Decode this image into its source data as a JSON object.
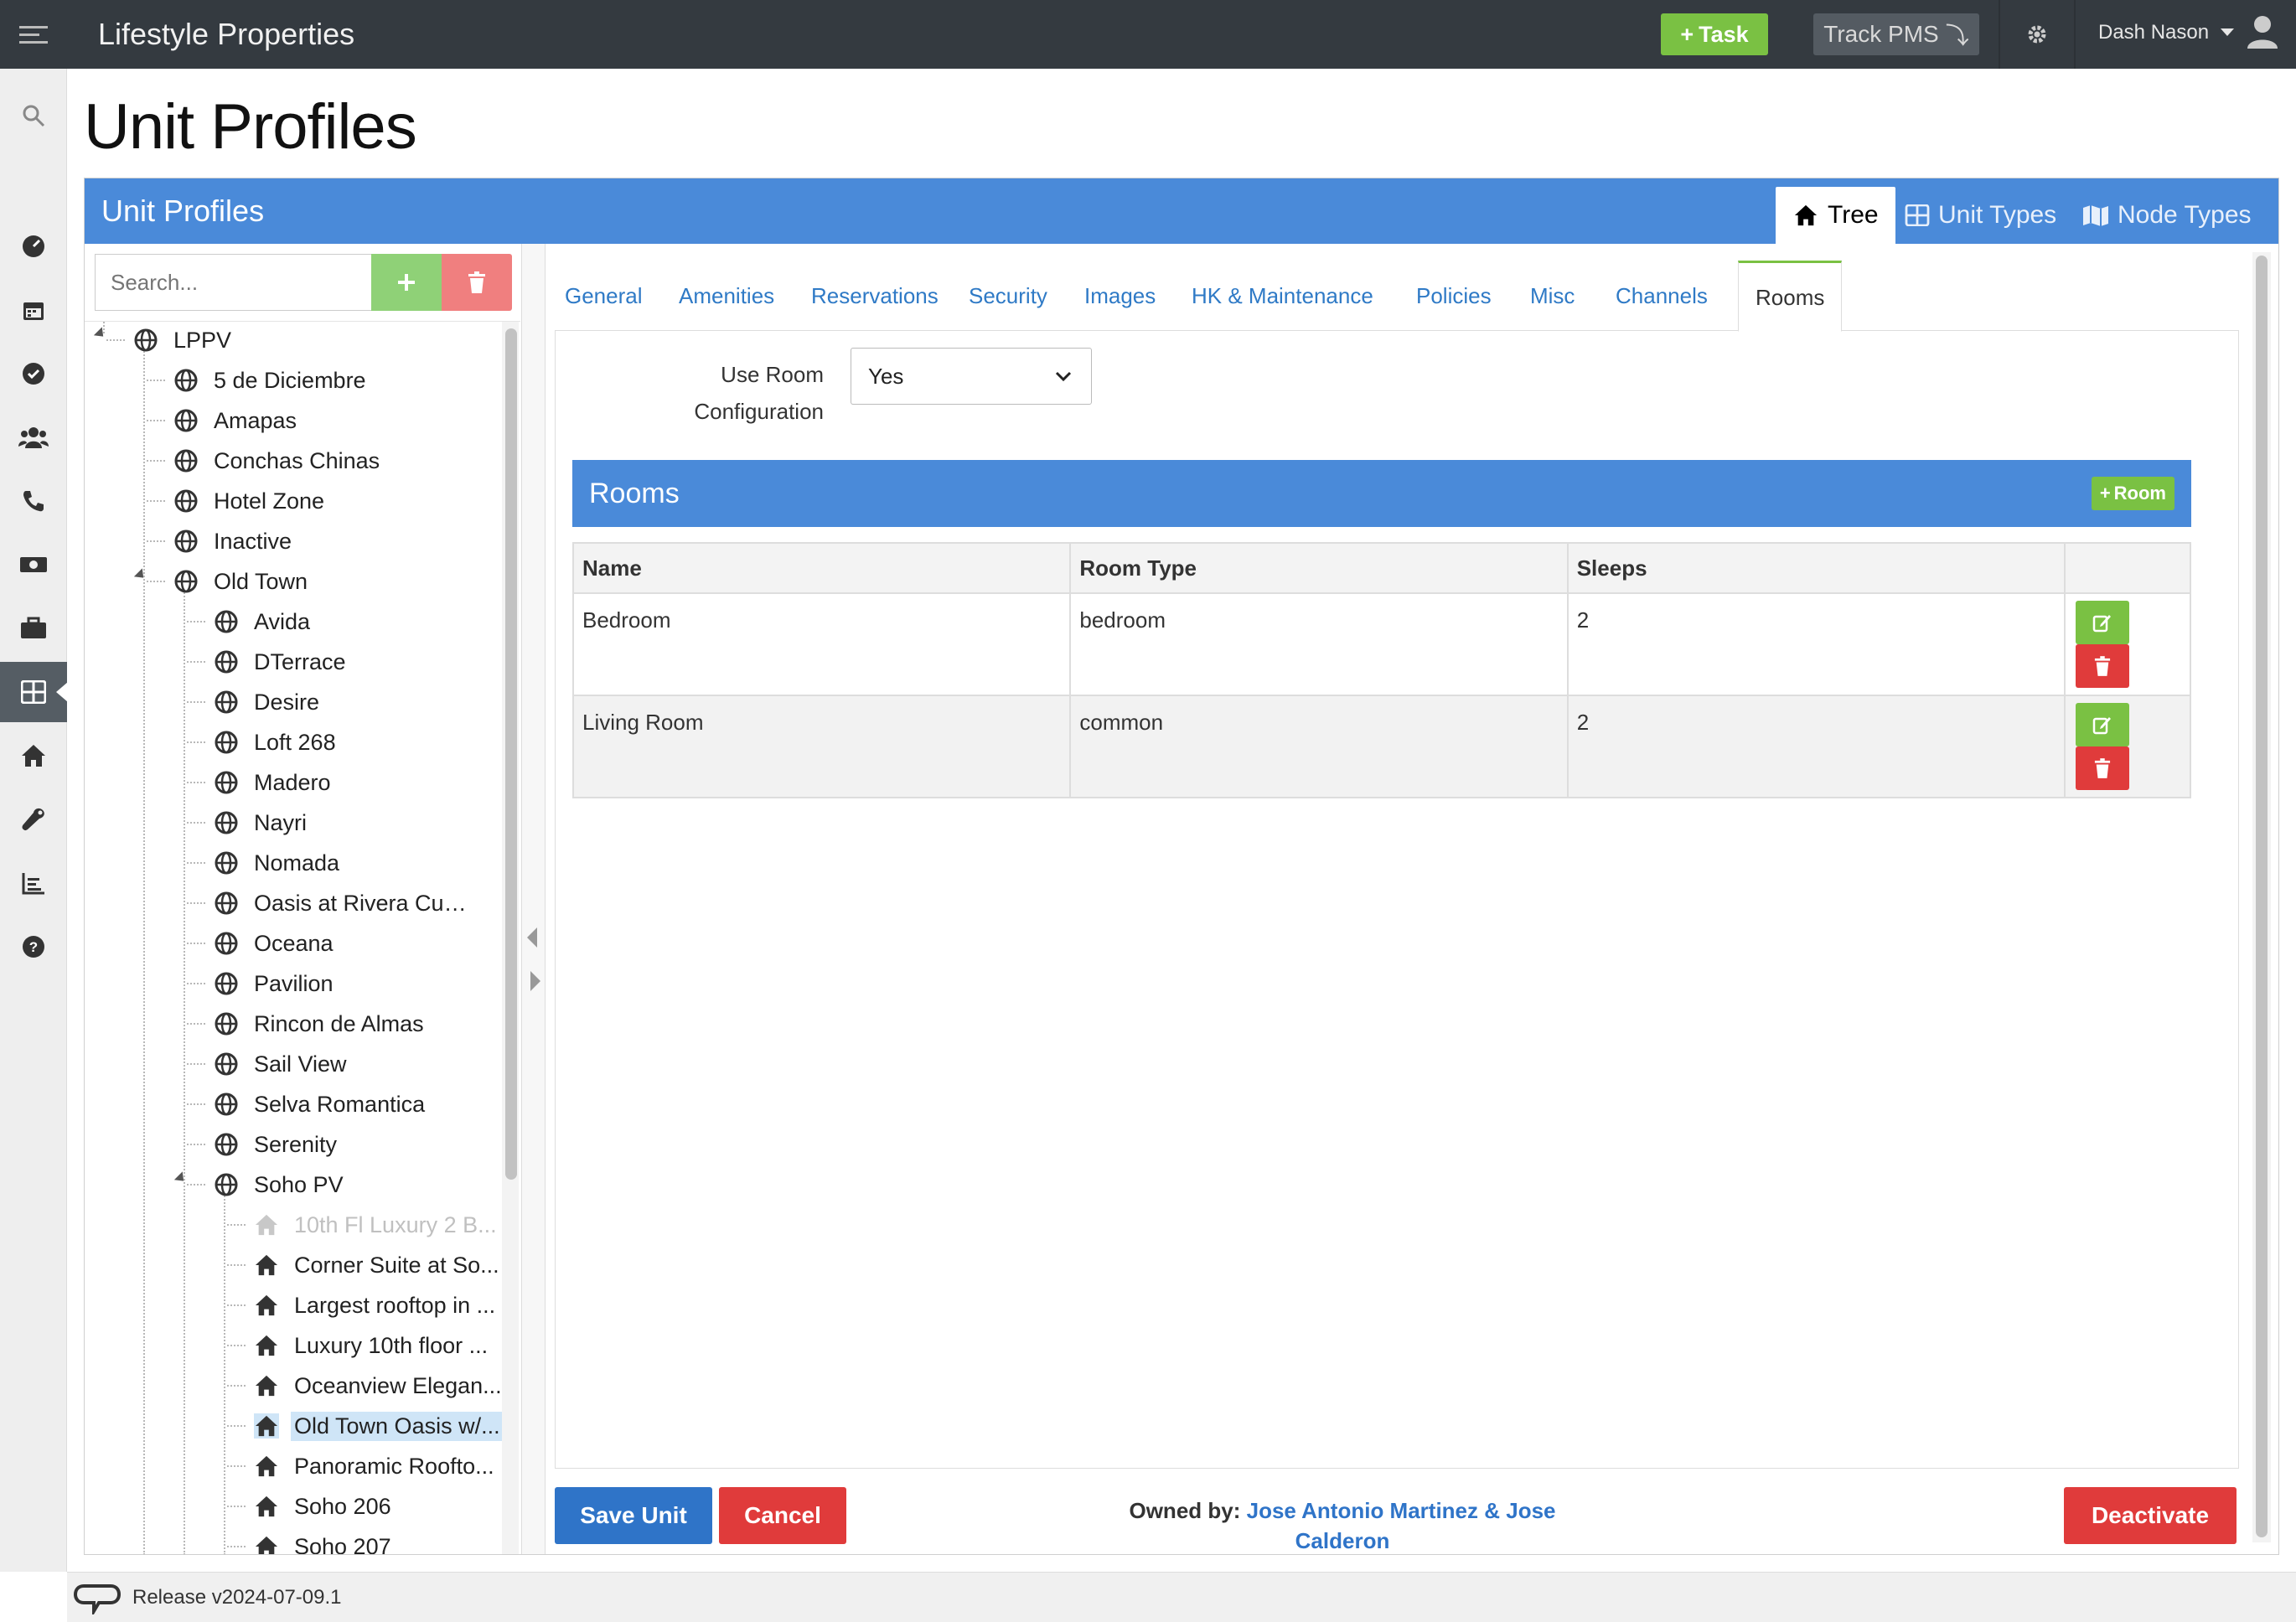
{
  "app": {
    "title": "Lifestyle Properties"
  },
  "header": {
    "task_label": "Task",
    "track_label": "Track PMS",
    "user_name": "Dash Nason"
  },
  "page": {
    "title": "Unit Profiles"
  },
  "panel": {
    "title": "Unit Profiles",
    "view_tabs": [
      "Tree",
      "Unit Types",
      "Node Types"
    ]
  },
  "tree": {
    "search_placeholder": "Search...",
    "nodes": [
      "LPPV",
      "5 de Diciembre",
      "Amapas",
      "Conchas Chinas",
      "Hotel Zone",
      "Inactive",
      "Old Town",
      "Avida",
      "DTerrace",
      "Desire",
      "Loft 268",
      "Madero",
      "Nayri",
      "Nomada",
      "Oasis at Rivera Cuale",
      "Oceana",
      "Pavilion",
      "Rincon de Almas",
      "Sail View",
      "Selva Romantica",
      "Serenity",
      "Soho PV",
      "10th Fl Luxury 2 B...",
      "Corner Suite at So...",
      "Largest rooftop in ...",
      "Luxury 10th floor ...",
      "Oceanview Elegan...",
      "Old Town Oasis w/...",
      "Panoramic Roofto...",
      "Soho 206",
      "Soho 207"
    ]
  },
  "tabs": [
    "General",
    "Amenities",
    "Reservations",
    "Security",
    "Images",
    "HK & Maintenance",
    "Policies",
    "Misc",
    "Channels",
    "Rooms"
  ],
  "room_config": {
    "label": "Use Room Configuration",
    "value": "Yes"
  },
  "rooms": {
    "title": "Rooms",
    "add_label": "Room",
    "columns": [
      "Name",
      "Room Type",
      "Sleeps"
    ],
    "rows": [
      {
        "name": "Bedroom",
        "type": "bedroom",
        "sleeps": "2"
      },
      {
        "name": "Living Room",
        "type": "common",
        "sleeps": "2"
      }
    ]
  },
  "actions": {
    "save": "Save Unit",
    "cancel": "Cancel",
    "deactivate": "Deactivate",
    "owned_label": "Owned by:",
    "owner_line1": "Jose Antonio Martinez & Jose",
    "owner_line2": "Calderon"
  },
  "footer": {
    "release": "Release v2024-07-09.1"
  },
  "colors": {
    "accent": "#4a8ad9",
    "success": "#7ac143",
    "danger": "#e03b3b",
    "topbar": "#343a40"
  }
}
